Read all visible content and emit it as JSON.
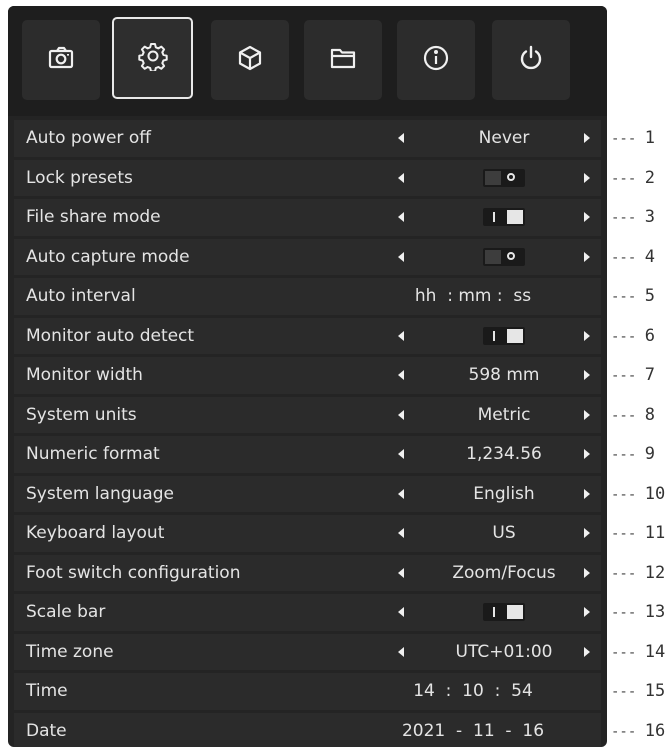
{
  "tabs": [
    {
      "name": "camera-icon",
      "active": false
    },
    {
      "name": "gear-icon",
      "active": true
    },
    {
      "name": "cube-icon",
      "active": false
    },
    {
      "name": "folder-icon",
      "active": false
    },
    {
      "name": "info-icon",
      "active": false
    },
    {
      "name": "power-icon",
      "active": false
    }
  ],
  "settings": [
    {
      "label": "Auto power off",
      "type": "select",
      "value": "Never",
      "callout": "1"
    },
    {
      "label": "Lock presets",
      "type": "toggle",
      "state": "off",
      "callout": "2"
    },
    {
      "label": "File share mode",
      "type": "toggle",
      "state": "on",
      "callout": "3"
    },
    {
      "label": "Auto capture mode",
      "type": "toggle",
      "state": "off",
      "callout": "4"
    },
    {
      "label": "Auto interval",
      "type": "time",
      "value": "hh  : mm :  ss",
      "callout": "5"
    },
    {
      "label": "Monitor auto detect",
      "type": "toggle",
      "state": "on",
      "callout": "6"
    },
    {
      "label": "Monitor width",
      "type": "select",
      "value": "598 mm",
      "callout": "7"
    },
    {
      "label": "System units",
      "type": "select",
      "value": "Metric",
      "callout": "8"
    },
    {
      "label": "Numeric format",
      "type": "select",
      "value": "1,234.56",
      "callout": "9"
    },
    {
      "label": "System language",
      "type": "select",
      "value": "English",
      "callout": "10"
    },
    {
      "label": "Keyboard layout",
      "type": "select",
      "value": "US",
      "callout": "11"
    },
    {
      "label": "Foot switch configuration",
      "type": "select",
      "value": "Zoom/Focus",
      "callout": "12"
    },
    {
      "label": "Scale bar",
      "type": "toggle",
      "state": "on",
      "callout": "13"
    },
    {
      "label": "Time zone",
      "type": "select",
      "value": "UTC+01:00",
      "callout": "14"
    },
    {
      "label": "Time",
      "type": "time",
      "value": "14  :  10  :  54",
      "callout": "15"
    },
    {
      "label": "Date",
      "type": "time",
      "value": "2021  -  11  -  16",
      "callout": "16"
    }
  ],
  "colors": {
    "panel": "#242424",
    "row": "#2b2b2b",
    "text": "#e4e4e4",
    "accent_border": "#e8e8e8"
  }
}
